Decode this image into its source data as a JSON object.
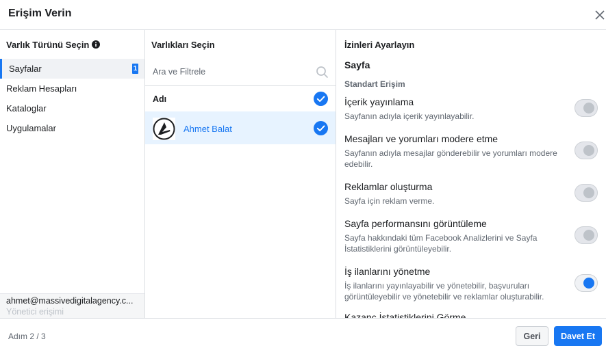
{
  "dialog": {
    "title": "Erişim Verin"
  },
  "asset_types": {
    "heading": "Varlık Türünü Seçin",
    "items": [
      {
        "label": "Sayfalar",
        "badge": "1",
        "active": true
      },
      {
        "label": "Reklam Hesapları"
      },
      {
        "label": "Kataloglar"
      },
      {
        "label": "Uygulamalar"
      }
    ],
    "account": {
      "email": "ahmet@massivedigitalagency.c...",
      "role": "Yönetici erişimi"
    }
  },
  "assets": {
    "heading": "Varlıkları Seçin",
    "search_placeholder": "Ara ve Filtrele",
    "column_label": "Adı",
    "items": [
      {
        "name": "Ahmet Balat",
        "checked": true
      }
    ]
  },
  "permissions": {
    "heading": "İzinleri Ayarlayın",
    "section": "Sayfa",
    "subsection": "Standart Erişim",
    "items": [
      {
        "title": "İçerik yayınlama",
        "desc": "Sayfanın adıyla içerik yayınlayabilir.",
        "on": false
      },
      {
        "title": "Mesajları ve yorumları modere etme",
        "desc": "Sayfanın adıyla mesajlar gönderebilir ve yorumları modere edebilir.",
        "on": false
      },
      {
        "title": "Reklamlar oluşturma",
        "desc": "Sayfa için reklam verme.",
        "on": false
      },
      {
        "title": "Sayfa performansını görüntüleme",
        "desc": "Sayfa hakkındaki tüm Facebook Analizlerini ve Sayfa İstatistiklerini görüntüleyebilir.",
        "on": false
      },
      {
        "title": "İş ilanlarını yönetme",
        "desc": "İş ilanlarını yayınlayabilir ve yönetebilir, başvuruları görüntüleyebilir ve yönetebilir ve reklamlar oluşturabilir.",
        "on": true
      }
    ],
    "cut_item": "Kazanç İstatistiklerini Görme"
  },
  "footer": {
    "step": "Adım 2 / 3",
    "back": "Geri",
    "invite": "Davet Et"
  },
  "colors": {
    "accent": "#1877f2",
    "selected_row": "#e7f3ff",
    "border": "#dadde1"
  }
}
